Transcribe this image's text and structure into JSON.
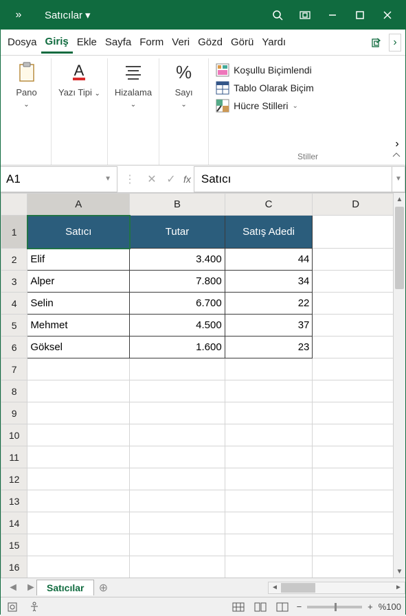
{
  "title": {
    "document_name": "Satıcılar"
  },
  "tabs": {
    "dosya": "Dosya",
    "giris": "Giriş",
    "ekle": "Ekle",
    "sayfa": "Sayfa",
    "form": "Form",
    "veri": "Veri",
    "gozd": "Gözd",
    "goru": "Görü",
    "yard": "Yardı"
  },
  "ribbon": {
    "pano": "Pano",
    "yazi": "Yazı Tipi",
    "hizalama": "Hizalama",
    "sayi": "Sayı",
    "kosullu": "Koşullu Biçimlendi",
    "tablo": "Tablo Olarak Biçim",
    "hucre": "Hücre Stilleri",
    "stiller": "Stiller"
  },
  "namebox": {
    "ref": "A1"
  },
  "formula_bar": {
    "fx": "fx",
    "value": "Satıcı"
  },
  "columns": [
    "A",
    "B",
    "C",
    "D"
  ],
  "data": {
    "headers": {
      "c1": "Satıcı",
      "c2": "Tutar",
      "c3": "Satış Adedi"
    },
    "rows": [
      {
        "c1": "Elif",
        "c2": "3.400",
        "c3": "44"
      },
      {
        "c1": "Alper",
        "c2": "7.800",
        "c3": "34"
      },
      {
        "c1": "Selin",
        "c2": "6.700",
        "c3": "22"
      },
      {
        "c1": "Mehmet",
        "c2": "4.500",
        "c3": "37"
      },
      {
        "c1": "Göksel",
        "c2": "1.600",
        "c3": "23"
      }
    ]
  },
  "sheet_tab": "Satıcılar",
  "zoom": "%100",
  "chart_data": {
    "type": "table",
    "title": "Satıcılar",
    "columns": [
      "Satıcı",
      "Tutar",
      "Satış Adedi"
    ],
    "rows": [
      [
        "Elif",
        3400,
        44
      ],
      [
        "Alper",
        7800,
        34
      ],
      [
        "Selin",
        6700,
        22
      ],
      [
        "Mehmet",
        4500,
        37
      ],
      [
        "Göksel",
        1600,
        23
      ]
    ]
  }
}
